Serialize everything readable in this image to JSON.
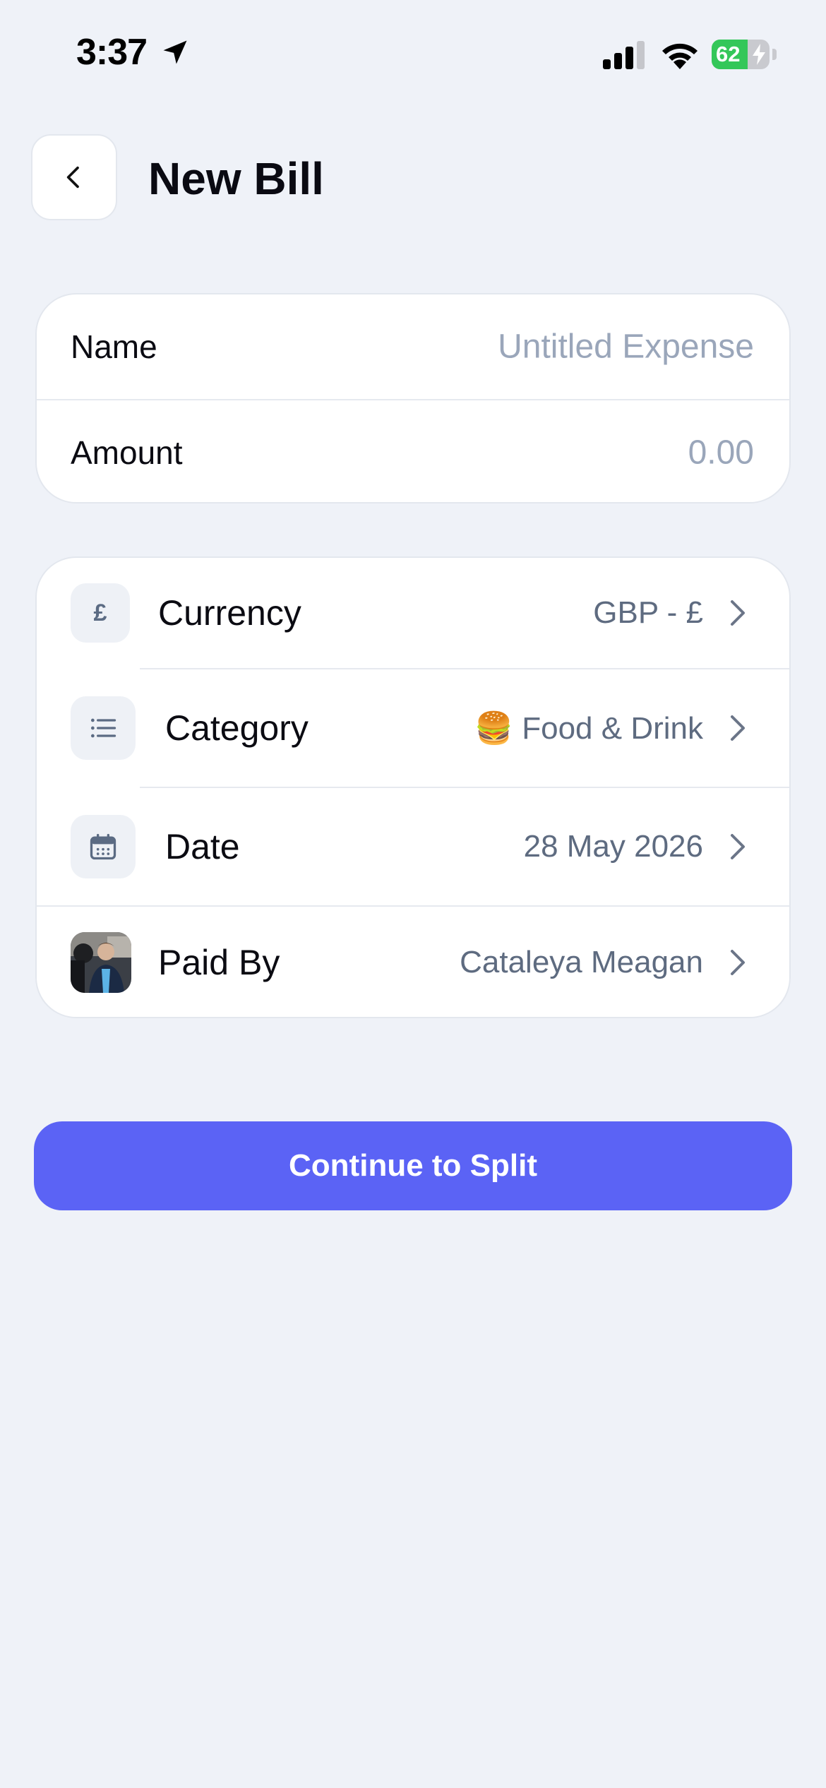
{
  "status_bar": {
    "time": "3:37",
    "battery_percent": 62,
    "battery_label": "62"
  },
  "header": {
    "back_icon": "chevron-left-icon",
    "title": "New Bill"
  },
  "basic_fields": {
    "name": {
      "label": "Name",
      "value": "",
      "placeholder": "Untitled Expense"
    },
    "amount": {
      "label": "Amount",
      "value": "",
      "placeholder": "0.00"
    }
  },
  "details": {
    "currency": {
      "label": "Currency",
      "value": "GBP - £",
      "icon": "pound-icon"
    },
    "category": {
      "label": "Category",
      "value": "🍔 Food & Drink",
      "icon": "list-icon"
    },
    "date": {
      "label": "Date",
      "value": "28 May 2026",
      "icon": "calendar-icon"
    },
    "paid_by": {
      "label": "Paid By",
      "value": "Cataleya Meagan",
      "icon": "avatar"
    }
  },
  "primary_action": {
    "label": "Continue to Split"
  },
  "colors": {
    "background": "#EFF2F8",
    "accent": "#5B63F5",
    "muted_text": "#5E6B80",
    "placeholder": "#9AA6BA",
    "battery_green": "#34C759"
  }
}
